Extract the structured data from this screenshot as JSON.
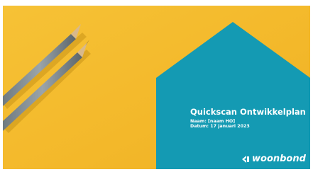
{
  "slide": {
    "title": "Quickscan Ontwikkelplan",
    "name_line": "Naam: [naam HO]",
    "date_line": "Datum: 17 januari 2023"
  },
  "brand": {
    "logo_text": "woonbond",
    "logo_icon": "woonbond-logo-icon"
  },
  "background": {
    "image": "two-pencils-on-yellow",
    "icon": "pencils-image"
  },
  "colors": {
    "yellow": "#F4BB2B",
    "teal": "#149AB3",
    "white": "#FFFFFF"
  }
}
